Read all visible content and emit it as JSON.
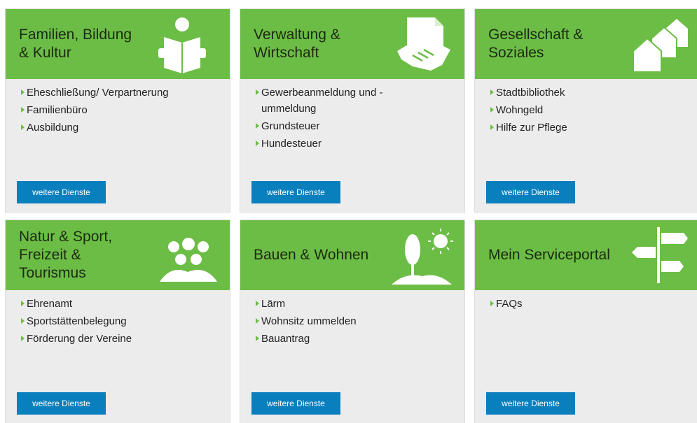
{
  "cards": [
    {
      "title": "Familien, Bildung\n& Kultur",
      "icon": "reading-person-icon",
      "items": [
        "Eheschließung/ Verpartnerung",
        "Familienbüro",
        "Ausbildung"
      ],
      "button": "weitere Dienste"
    },
    {
      "title": "Verwaltung &\nWirtschaft",
      "icon": "handshake-document-icon",
      "items": [
        "Gewerbeanmeldung und -\nummeldung",
        "Grundsteuer",
        "Hundesteuer"
      ],
      "button": "weitere Dienste"
    },
    {
      "title": "Gesellschaft &\nSoziales",
      "icon": "houses-icon",
      "items": [
        "Stadtbibliothek",
        "Wohngeld",
        "Hilfe zur Pflege"
      ],
      "button": "weitere Dienste"
    },
    {
      "title": "Natur & Sport,\nFreizeit &\nTourismus",
      "icon": "group-of-people-icon",
      "items": [
        "Ehrenamt",
        "Sportstättenbelegung",
        "Förderung der Vereine"
      ],
      "button": "weitere Dienste"
    },
    {
      "title": "Bauen & Wohnen",
      "icon": "tree-sun-icon",
      "items": [
        "Lärm",
        "Wohnsitz ummelden",
        "Bauantrag"
      ],
      "button": "weitere Dienste"
    },
    {
      "title": "Mein Serviceportal",
      "icon": "signpost-icon",
      "items": [
        "FAQs"
      ],
      "button": "weitere Dienste"
    }
  ],
  "colors": {
    "header_green": "#6cbd45",
    "button_blue": "#0a7fbd",
    "card_bg": "#ececec"
  }
}
